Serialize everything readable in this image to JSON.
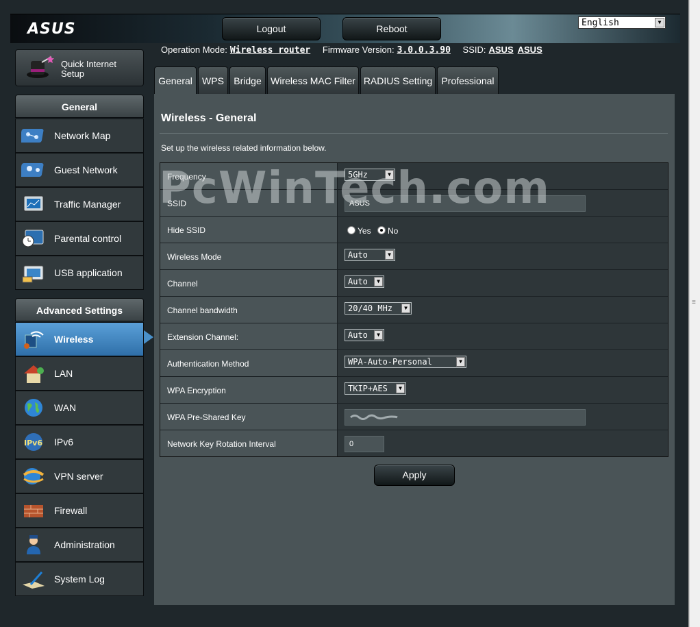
{
  "header": {
    "logo": "ASUS",
    "logout_label": "Logout",
    "reboot_label": "Reboot",
    "language": "English"
  },
  "infobar": {
    "operation_mode_label": "Operation Mode:",
    "operation_mode_value": "Wireless router",
    "firmware_label": "Firmware Version:",
    "firmware_value": "3.0.0.3.90",
    "ssid_label": "SSID:",
    "ssid_value1": "ASUS",
    "ssid_value2": "ASUS"
  },
  "sidebar": {
    "quick_setup_label": "Quick Internet Setup",
    "general_title": "General",
    "general_items": [
      {
        "label": "Network Map",
        "icon": "network-map-icon"
      },
      {
        "label": "Guest Network",
        "icon": "guest-network-icon"
      },
      {
        "label": "Traffic Manager",
        "icon": "traffic-manager-icon"
      },
      {
        "label": "Parental control",
        "icon": "parental-control-icon"
      },
      {
        "label": "USB application",
        "icon": "usb-application-icon"
      }
    ],
    "advanced_title": "Advanced Settings",
    "advanced_items": [
      {
        "label": "Wireless",
        "icon": "wireless-icon",
        "active": true
      },
      {
        "label": "LAN",
        "icon": "lan-icon"
      },
      {
        "label": "WAN",
        "icon": "wan-icon"
      },
      {
        "label": "IPv6",
        "icon": "ipv6-icon"
      },
      {
        "label": "VPN server",
        "icon": "vpn-server-icon"
      },
      {
        "label": "Firewall",
        "icon": "firewall-icon"
      },
      {
        "label": "Administration",
        "icon": "administration-icon"
      },
      {
        "label": "System Log",
        "icon": "system-log-icon"
      }
    ]
  },
  "tabs": [
    {
      "label": "General",
      "active": true
    },
    {
      "label": "WPS"
    },
    {
      "label": "Bridge"
    },
    {
      "label": "Wireless MAC Filter"
    },
    {
      "label": "RADIUS Setting"
    },
    {
      "label": "Professional"
    }
  ],
  "panel": {
    "title": "Wireless - General",
    "description": "Set up the wireless related information below.",
    "watermark": "PcWinTech.com",
    "fields": {
      "frequency": {
        "label": "Frequency",
        "value": "5GHz"
      },
      "ssid": {
        "label": "SSID",
        "value": "ASUS"
      },
      "hide_ssid": {
        "label": "Hide SSID",
        "yes": "Yes",
        "no": "No",
        "selected": "No"
      },
      "wireless_mode": {
        "label": "Wireless Mode",
        "value": "Auto"
      },
      "channel": {
        "label": "Channel",
        "value": "Auto"
      },
      "channel_bandwidth": {
        "label": "Channel bandwidth",
        "value": "20/40 MHz"
      },
      "extension_channel": {
        "label": "Extension Channel:",
        "value": "Auto"
      },
      "auth_method": {
        "label": "Authentication Method",
        "value": "WPA-Auto-Personal"
      },
      "wpa_encryption": {
        "label": "WPA Encryption",
        "value": "TKIP+AES"
      },
      "wpa_psk": {
        "label": "WPA Pre-Shared Key",
        "value": ""
      },
      "key_rotation": {
        "label": "Network Key Rotation Interval",
        "value": "0"
      }
    },
    "apply_label": "Apply"
  },
  "colors": {
    "panel_bg": "#4a5457",
    "active_menu": "#3b80bd",
    "frame_bg": "#1f272b"
  }
}
